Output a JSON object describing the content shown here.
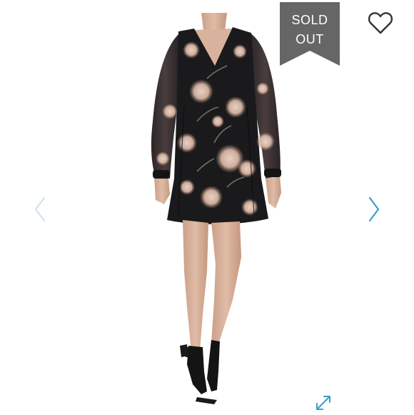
{
  "badge": {
    "line1": "SOLD",
    "line2": "OUT",
    "color": "#666666"
  },
  "icons": {
    "favorite": "heart-outline-icon",
    "prev": "chevron-left-icon",
    "next": "chevron-right-icon",
    "expand": "expand-icon"
  },
  "colors": {
    "arrow": "#3b9fc7",
    "arrow_disabled": "#cfe2ea",
    "dress": "#1b1b1d",
    "floral": "#e6c9b9"
  }
}
